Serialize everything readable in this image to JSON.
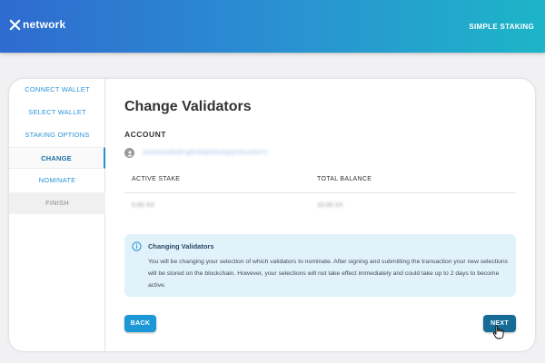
{
  "header": {
    "brand": "network",
    "right_link": "SIMPLE STAKING",
    "brand_icon": "x-logo-icon"
  },
  "steps": [
    {
      "label": "CONNECT WALLET",
      "state": "completed"
    },
    {
      "label": "SELECT WALLET",
      "state": "completed"
    },
    {
      "label": "STAKING OPTIONS",
      "state": "completed"
    },
    {
      "label": "CHANGE",
      "state": "active"
    },
    {
      "label": "NOMINATE",
      "state": "upcoming"
    },
    {
      "label": "FINISH",
      "state": "disabled"
    }
  ],
  "main": {
    "title": "Change Validators",
    "account_label": "ACCOUNT",
    "account_address": "1A2b3c4d5e6f7g8h9i0jKlMnOpQrStUvWxYz",
    "table": {
      "headers": [
        "ACTIVE STAKE",
        "TOTAL BALANCE"
      ],
      "values": [
        "0.00 XX",
        "10.00 XX"
      ]
    },
    "info": {
      "title": "Changing Validators",
      "body": "You will be changing your selection of which validators to nominate. After signing and submitting the transaction your new selections will be stored on the blockchain. However, your selections will not take effect immediately and could take up to 2 days to become active."
    },
    "buttons": {
      "back": "BACK",
      "next": "NEXT"
    }
  },
  "colors": {
    "accent": "#2a94d6",
    "next_button": "#176b97",
    "info_bg": "#e2f2fb"
  }
}
